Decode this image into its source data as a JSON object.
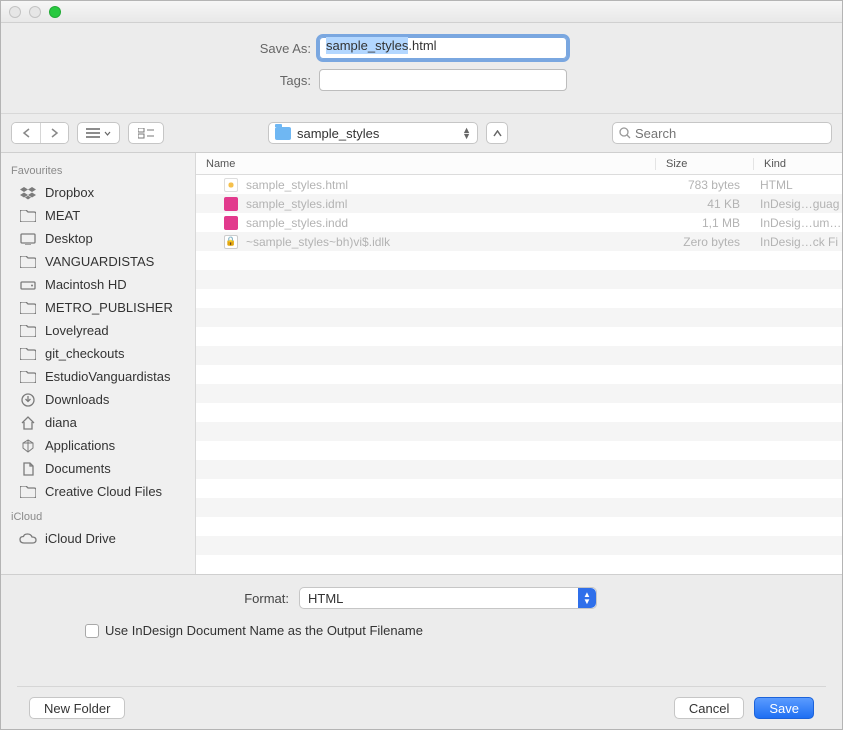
{
  "form": {
    "save_as_label": "Save As:",
    "save_as_value_sel": "sample_styles",
    "save_as_value_rest": ".html",
    "tags_label": "Tags:",
    "tags_value": ""
  },
  "toolbar": {
    "location": "sample_styles",
    "search_placeholder": "Search"
  },
  "sidebar": {
    "sections": [
      {
        "heading": "Favourites",
        "items": [
          {
            "icon": "dropbox-icon",
            "label": "Dropbox"
          },
          {
            "icon": "folder-icon",
            "label": "MEAT"
          },
          {
            "icon": "desktop-icon",
            "label": "Desktop"
          },
          {
            "icon": "folder-icon",
            "label": "VANGUARDISTAS"
          },
          {
            "icon": "hdd-icon",
            "label": "Macintosh HD"
          },
          {
            "icon": "folder-icon",
            "label": "METRO_PUBLISHER"
          },
          {
            "icon": "folder-icon",
            "label": "Lovelyread"
          },
          {
            "icon": "folder-icon",
            "label": "git_checkouts"
          },
          {
            "icon": "folder-icon",
            "label": "EstudioVanguardistas"
          },
          {
            "icon": "downloads-icon",
            "label": "Downloads"
          },
          {
            "icon": "home-icon",
            "label": "diana"
          },
          {
            "icon": "apps-icon",
            "label": "Applications"
          },
          {
            "icon": "documents-icon",
            "label": "Documents"
          },
          {
            "icon": "folder-icon",
            "label": "Creative Cloud Files"
          }
        ]
      },
      {
        "heading": "iCloud",
        "items": [
          {
            "icon": "cloud-icon",
            "label": "iCloud Drive"
          }
        ]
      }
    ]
  },
  "columns": {
    "name": "Name",
    "size": "Size",
    "kind": "Kind"
  },
  "files": [
    {
      "icon": "html",
      "name": "sample_styles.html",
      "size": "783 bytes",
      "kind": "HTML"
    },
    {
      "icon": "idml",
      "name": "sample_styles.idml",
      "size": "41 KB",
      "kind": "InDesig…guag"
    },
    {
      "icon": "indd",
      "name": "sample_styles.indd",
      "size": "1,1 MB",
      "kind": "InDesig…umen"
    },
    {
      "icon": "lock",
      "name": "~sample_styles~bh)vi$.idlk",
      "size": "Zero bytes",
      "kind": "InDesig…ck Fi"
    }
  ],
  "format": {
    "label": "Format:",
    "value": "HTML"
  },
  "checkbox_label": "Use InDesign Document Name as the Output Filename",
  "buttons": {
    "new_folder": "New Folder",
    "cancel": "Cancel",
    "save": "Save"
  }
}
